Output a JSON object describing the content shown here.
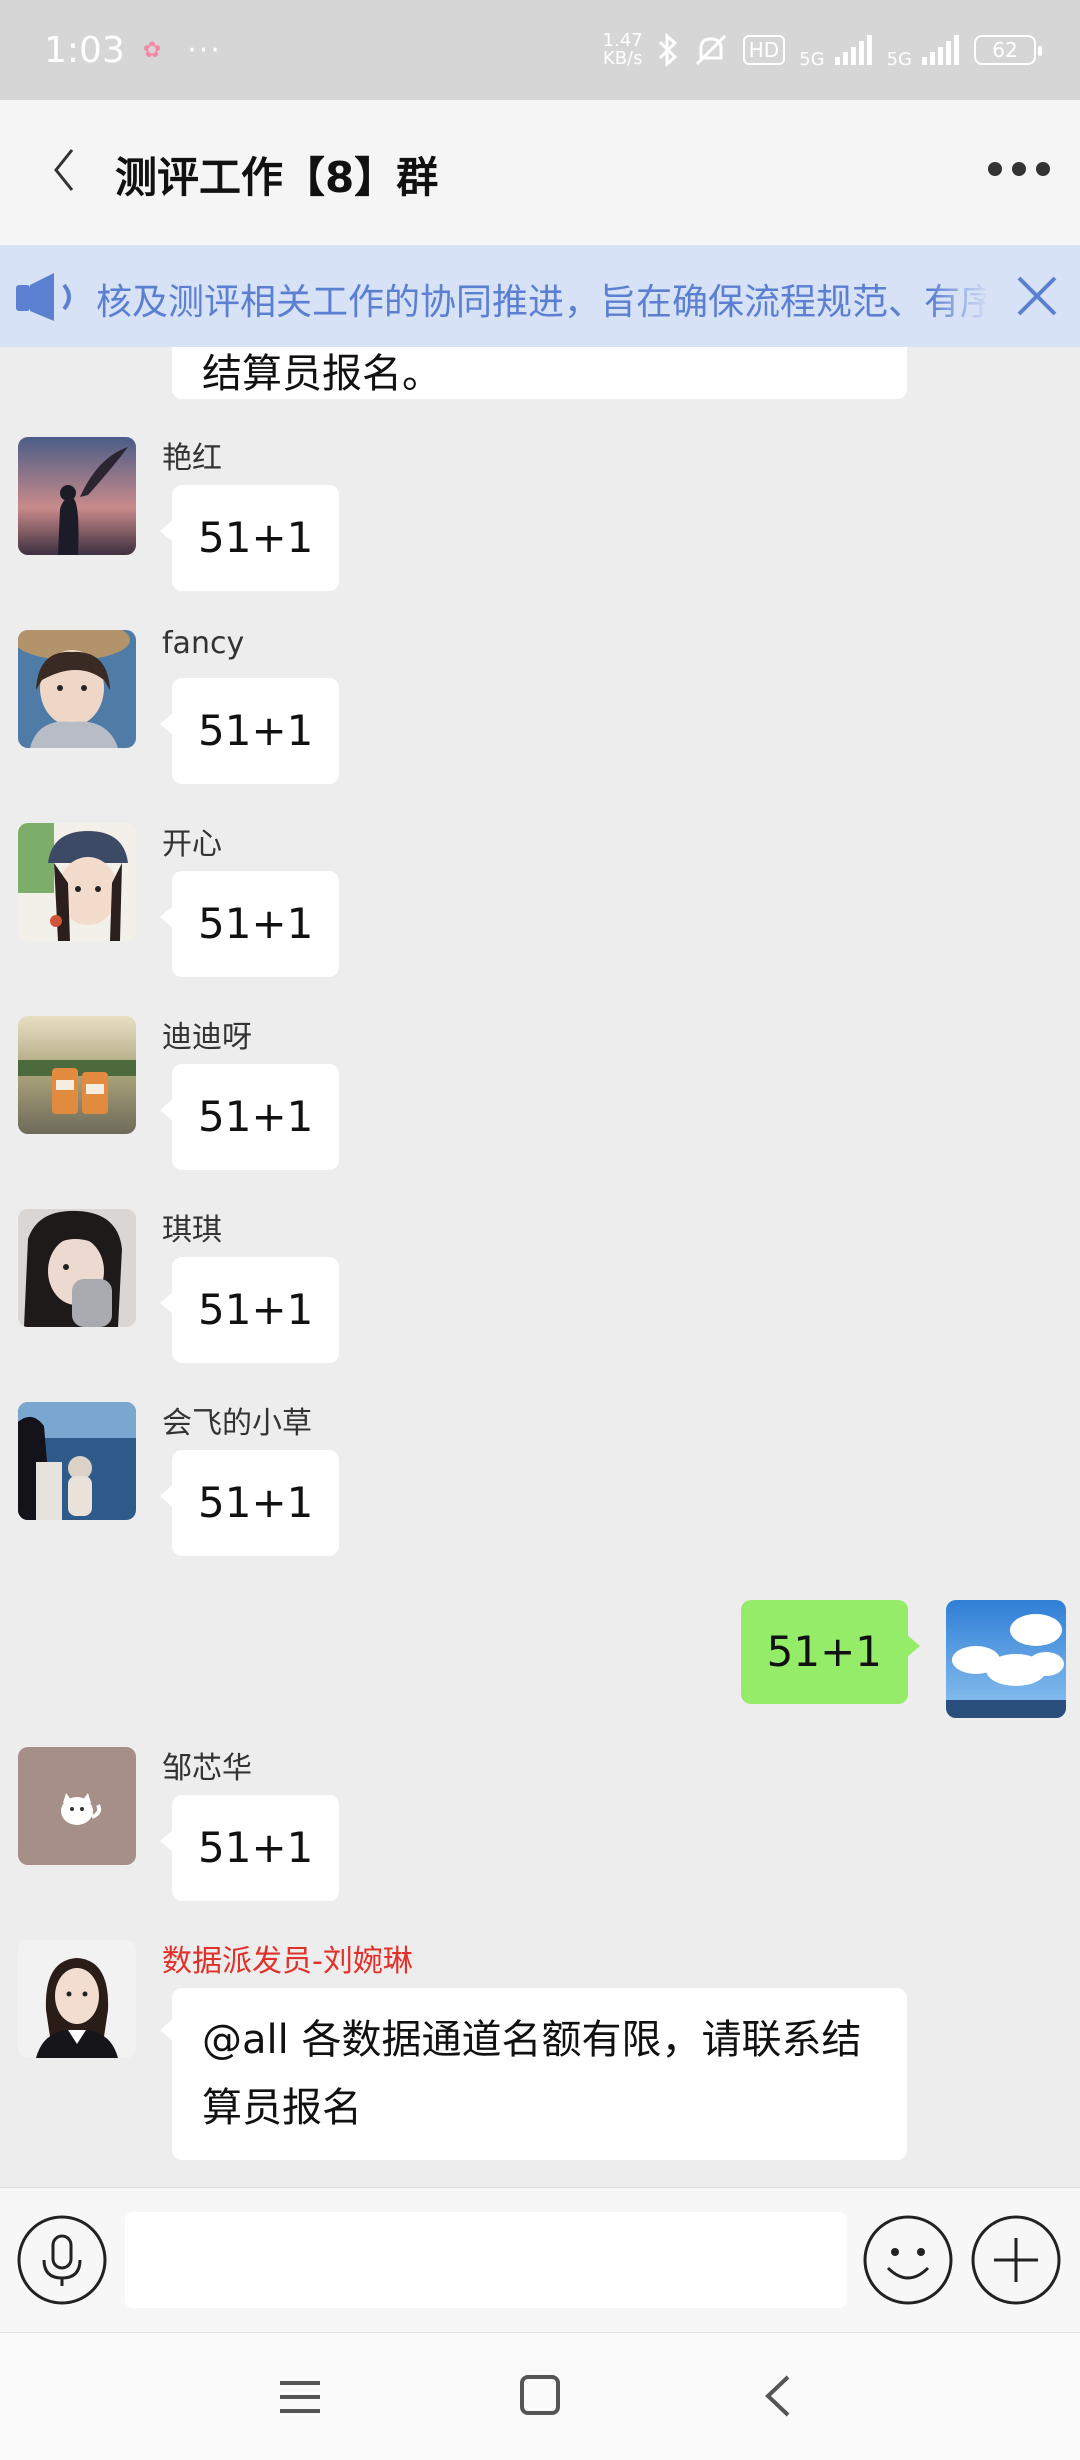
{
  "status_bar": {
    "time": "1:03",
    "more": "···",
    "net_speed_value": "1.47",
    "net_speed_unit": "KB/s",
    "hd_label": "HD",
    "net_type_1": "5G",
    "net_type_2": "5G",
    "battery": "62"
  },
  "header": {
    "title": "测评工作【8】群"
  },
  "announcement": {
    "text": "核及测评相关工作的协同推进，旨在确保流程规范、有序"
  },
  "messages": {
    "prev_tail": "结算员报名。",
    "m1": {
      "sender": "艳红",
      "text": "51+1"
    },
    "m2": {
      "sender": "fancy",
      "text": "51+1"
    },
    "m3": {
      "sender": "开心",
      "text": "51+1"
    },
    "m4": {
      "sender": "迪迪呀",
      "text": "51+1"
    },
    "m5": {
      "sender": "琪琪",
      "text": "51+1"
    },
    "m6": {
      "sender": "会飞的小草",
      "text": "51+1"
    },
    "self": {
      "text": "51+1"
    },
    "m7": {
      "sender": "邹芯华",
      "text": "51+1"
    },
    "m8": {
      "sender": "数据派发员-刘婉琳",
      "text": "@all 各数据通道名额有限，请联系结算员报名"
    }
  },
  "colors": {
    "accent_blue": "#5b7fd1",
    "self_bubble": "#95ec69",
    "admin_name": "#e0322b"
  },
  "icons": {
    "back": "chevron-left-icon",
    "more": "more-dots-icon",
    "announce": "speaker-icon",
    "close": "close-icon",
    "voice": "microphone-icon",
    "emoji": "emoji-icon",
    "plus": "plus-icon"
  }
}
